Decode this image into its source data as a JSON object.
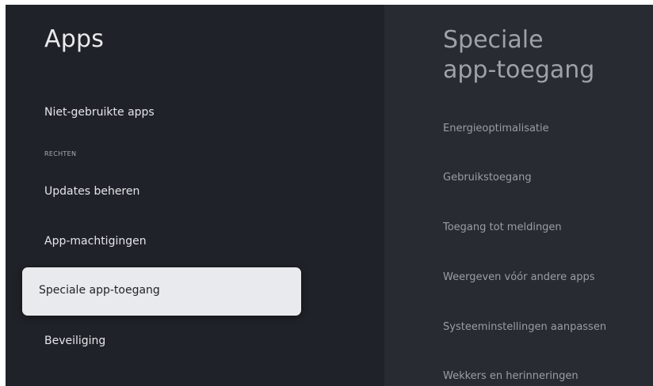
{
  "left_panel": {
    "title": "Apps",
    "items": [
      {
        "label": "Niet-gebruikte apps"
      },
      {
        "label": "Updates beheren"
      },
      {
        "label": "App-machtigingen"
      },
      {
        "label": "Speciale app-toegang",
        "focused": true
      },
      {
        "label": "Beveiliging"
      }
    ],
    "section_header": "RECHTEN"
  },
  "right_panel": {
    "title_line1": "Speciale",
    "title_line2": "app-toegang",
    "items": [
      {
        "label": "Energieoptimalisatie"
      },
      {
        "label": "Gebruikstoegang"
      },
      {
        "label": "Toegang tot meldingen"
      },
      {
        "label": "Weergeven vóór andere apps"
      },
      {
        "label": "Systeeminstellingen aanpassen"
      },
      {
        "label": "Wekkers en herinneringen"
      }
    ]
  },
  "colors": {
    "background": "#1f2228",
    "preview_background": "#282b31",
    "focus_highlight": "#e8eaed"
  }
}
